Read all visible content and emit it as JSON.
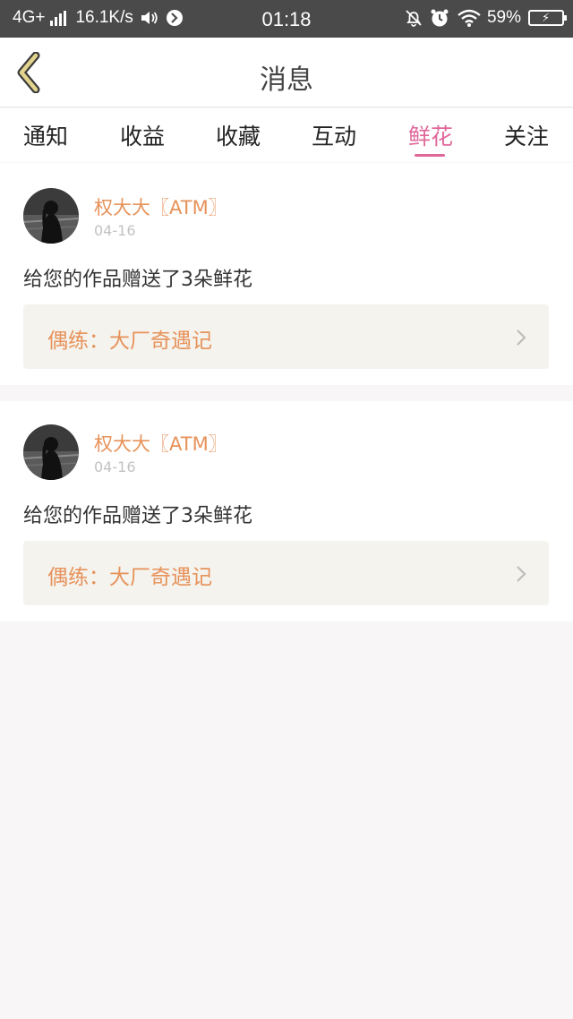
{
  "status_bar": {
    "network": "4G+",
    "speed": "16.1K/s",
    "time": "01:18",
    "battery": "59%",
    "icons": [
      "signal-icon",
      "speaker-icon",
      "app-icon",
      "alarm-off-icon",
      "alarm-clock-icon",
      "wifi-icon",
      "battery-icon"
    ]
  },
  "header": {
    "title": "消息",
    "back_icon": "chevron-left-icon",
    "accent": "#e2d48c"
  },
  "tabs": [
    {
      "label": "通知",
      "active": false
    },
    {
      "label": "收益",
      "active": false
    },
    {
      "label": "收藏",
      "active": false
    },
    {
      "label": "互动",
      "active": false
    },
    {
      "label": "鲜花",
      "active": true
    },
    {
      "label": "关注",
      "active": false
    }
  ],
  "colors": {
    "active_tab": "#e0679a",
    "username": "#e7925a",
    "link_text": "#e7925a",
    "link_bg": "#f4f3ee",
    "date": "#c2c2c2",
    "page_bg": "#f8f6f6"
  },
  "messages": [
    {
      "user": "权大大〖ATM〗",
      "date": "04-16",
      "text": "给您的作品赠送了3朵鲜花",
      "work_label": "偶练：大厂奇遇记",
      "avatar": "avatar-photo",
      "chevron": "chevron-right-icon"
    },
    {
      "user": "权大大〖ATM〗",
      "date": "04-16",
      "text": "给您的作品赠送了3朵鲜花",
      "work_label": "偶练：大厂奇遇记",
      "avatar": "avatar-photo",
      "chevron": "chevron-right-icon"
    }
  ]
}
